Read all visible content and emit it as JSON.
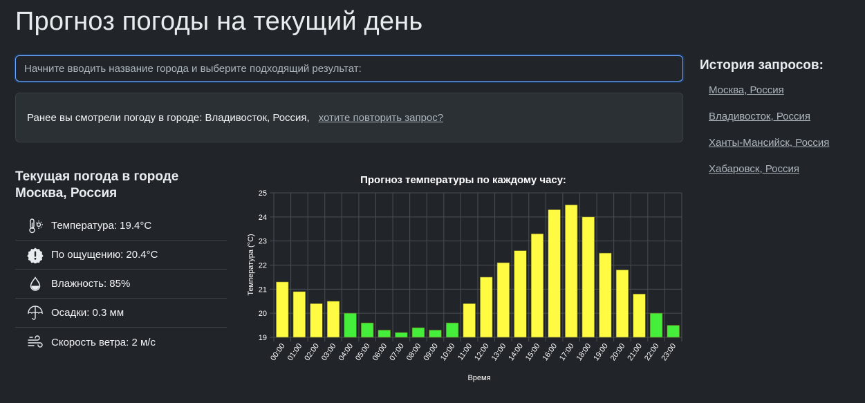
{
  "page_title": "Прогноз погоды на текущий день",
  "search": {
    "placeholder": "Начните вводить название города и выберите подходящий результат:",
    "value": ""
  },
  "previous": {
    "text": "Ранее вы смотрели погоду в городе: Владивосток, Россия,",
    "link_label": "хотите повторить запрос?"
  },
  "history": {
    "title": "История запросов:",
    "items": [
      "Москва, Россия",
      "Владивосток, Россия",
      "Ханты-Мансийск, Россия",
      "Хабаровск, Россия"
    ]
  },
  "current": {
    "heading": "Текущая погода в городе Москва, Россия",
    "items": [
      {
        "icon": "thermometer-sun-icon",
        "label": "Температура: 19.4°C"
      },
      {
        "icon": "alert-badge-icon",
        "label": "По ощущению: 20.4°C"
      },
      {
        "icon": "droplet-icon",
        "label": "Влажность: 85%"
      },
      {
        "icon": "umbrella-icon",
        "label": "Осадки: 0.3 мм"
      },
      {
        "icon": "wind-icon",
        "label": "Скорость ветра: 2 м/с"
      }
    ]
  },
  "colors": {
    "bar_warm": "#fffa42",
    "bar_cool": "#44ee3b",
    "bar_border": "#6b6b1e"
  },
  "chart_data": {
    "type": "bar",
    "title": "Прогноз температуры по каждому часу:",
    "xlabel": "Время",
    "ylabel": "Температура (°C)",
    "ylim": [
      19,
      25
    ],
    "y_ticks": [
      19,
      20,
      21,
      22,
      23,
      24,
      25
    ],
    "grid": true,
    "categories": [
      "00:00",
      "01:00",
      "02:00",
      "03:00",
      "04:00",
      "05:00",
      "06:00",
      "07:00",
      "08:00",
      "09:00",
      "10:00",
      "11:00",
      "12:00",
      "13:00",
      "14:00",
      "15:00",
      "16:00",
      "17:00",
      "18:00",
      "19:00",
      "20:00",
      "21:00",
      "22:00",
      "23:00"
    ],
    "values": [
      21.3,
      20.9,
      20.4,
      20.5,
      20.0,
      19.6,
      19.3,
      19.2,
      19.4,
      19.3,
      19.6,
      20.4,
      21.5,
      22.1,
      22.6,
      23.3,
      24.3,
      24.5,
      24.0,
      22.5,
      21.8,
      20.8,
      20.0,
      19.5
    ]
  }
}
